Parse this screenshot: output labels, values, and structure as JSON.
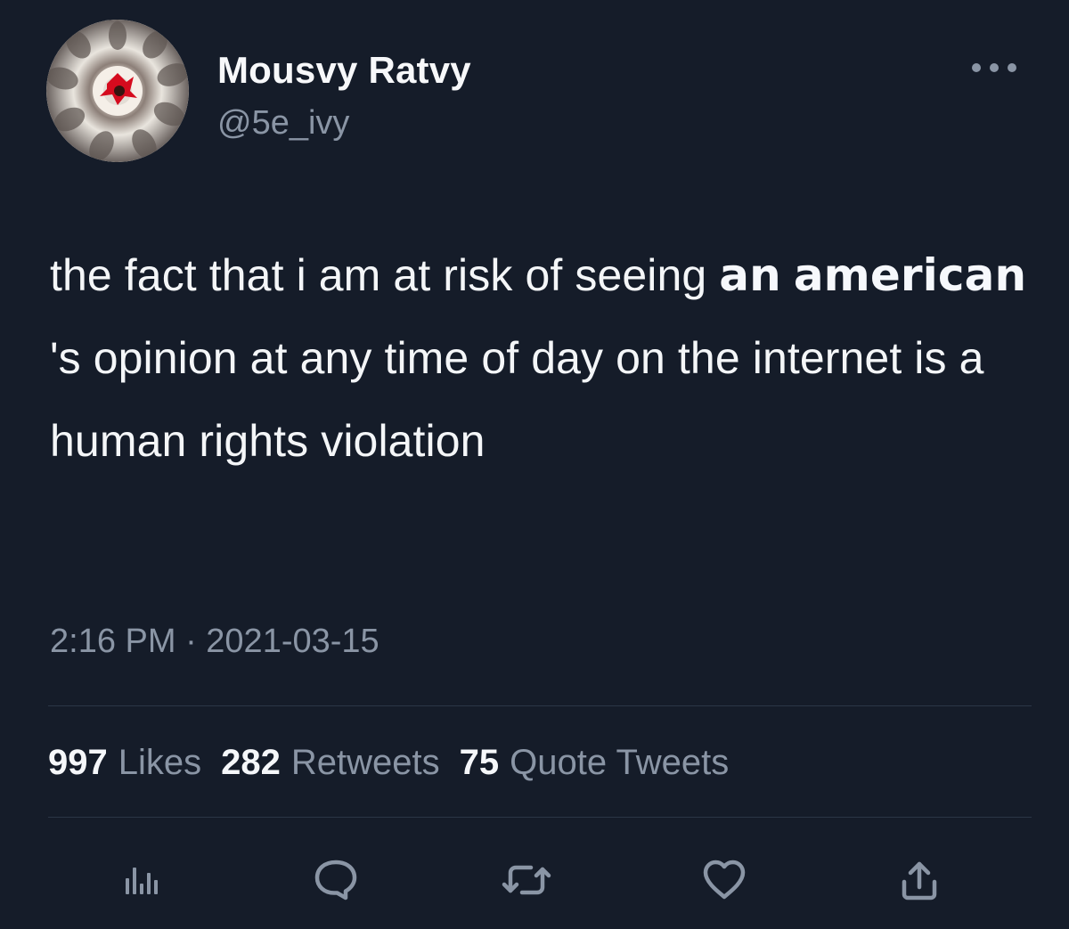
{
  "tweet": {
    "author": {
      "name": "Mousvy Ratvy",
      "handle": "@5e_ivy",
      "avatar_icon": "avatar-image"
    },
    "text_parts": {
      "p1": "the fact that i am at risk of seeing ",
      "p2": "an",
      "p3": " ",
      "p4": "american",
      "p5": " 's opinion at any time of day on the internet is a human rights violation"
    },
    "timestamp": "2:16 PM · 2021-03-15",
    "stats": [
      {
        "count": "997",
        "label": "Likes"
      },
      {
        "count": "282",
        "label": "Retweets"
      },
      {
        "count": "75",
        "label": "Quote Tweets"
      }
    ],
    "actions": {
      "more": "more-icon",
      "analytics": "analytics-icon",
      "reply": "reply-icon",
      "retweet": "retweet-icon",
      "like": "heart-icon",
      "share": "share-icon"
    },
    "colors": {
      "background": "#151c29",
      "text_primary": "#f4f6f8",
      "text_secondary": "#8a95a5",
      "divider": "#2b3646"
    }
  }
}
